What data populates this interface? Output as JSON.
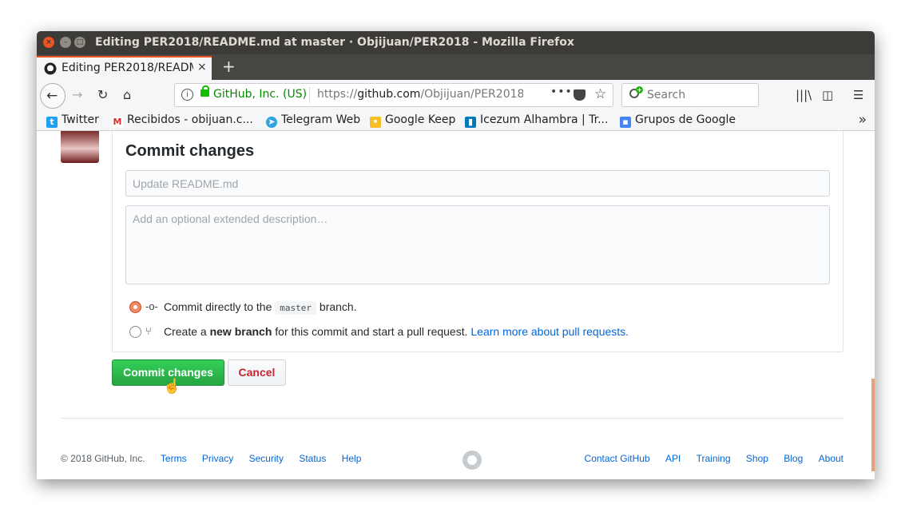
{
  "window": {
    "title": "Editing PER2018/README.md at master · Objijuan/PER2018 - Mozilla Firefox"
  },
  "tab": {
    "title": "Editing PER2018/READM",
    "close_label": "×",
    "new_tab_label": "+"
  },
  "urlbar": {
    "identity": "GitHub, Inc. (US)",
    "url_scheme": "https://",
    "url_host": "github.com",
    "url_path": "/Objijuan/PER2018",
    "more_label": "•••"
  },
  "searchbar": {
    "placeholder": "Search"
  },
  "bookmarks": [
    {
      "label": "Twitter",
      "icon": "twitter-icon",
      "color": "#1da1f2"
    },
    {
      "label": "Recibidos - obijuan.c...",
      "icon": "gmail-icon",
      "color": "#d93025"
    },
    {
      "label": "Telegram Web",
      "icon": "telegram-icon",
      "color": "#2ca5e0"
    },
    {
      "label": "Google Keep",
      "icon": "keep-icon",
      "color": "#f6bf26"
    },
    {
      "label": "Icezum Alhambra | Tr...",
      "icon": "trello-icon",
      "color": "#0079bf"
    },
    {
      "label": "Grupos de Google",
      "icon": "groups-icon",
      "color": "#4285f4"
    }
  ],
  "commit": {
    "heading": "Commit changes",
    "summary_placeholder": "Update README.md",
    "description_placeholder": "Add an optional extended description…",
    "option_direct": {
      "prefix": "Commit directly to the ",
      "branch": "master",
      "suffix": " branch."
    },
    "option_new_branch": {
      "prefix": "Create a ",
      "bold": "new branch",
      "middle": " for this commit and start a pull request. ",
      "link": "Learn more about pull requests."
    },
    "commit_button": "Commit changes",
    "cancel_button": "Cancel"
  },
  "footer": {
    "copyright": "© 2018 GitHub, Inc.",
    "left_links": [
      "Terms",
      "Privacy",
      "Security",
      "Status",
      "Help"
    ],
    "right_links": [
      "Contact GitHub",
      "API",
      "Training",
      "Shop",
      "Blog",
      "About"
    ]
  },
  "colors": {
    "accent": "#e95420",
    "commit_green": "#28a745",
    "cancel_red": "#cb2431",
    "link_blue": "#0366d6"
  }
}
